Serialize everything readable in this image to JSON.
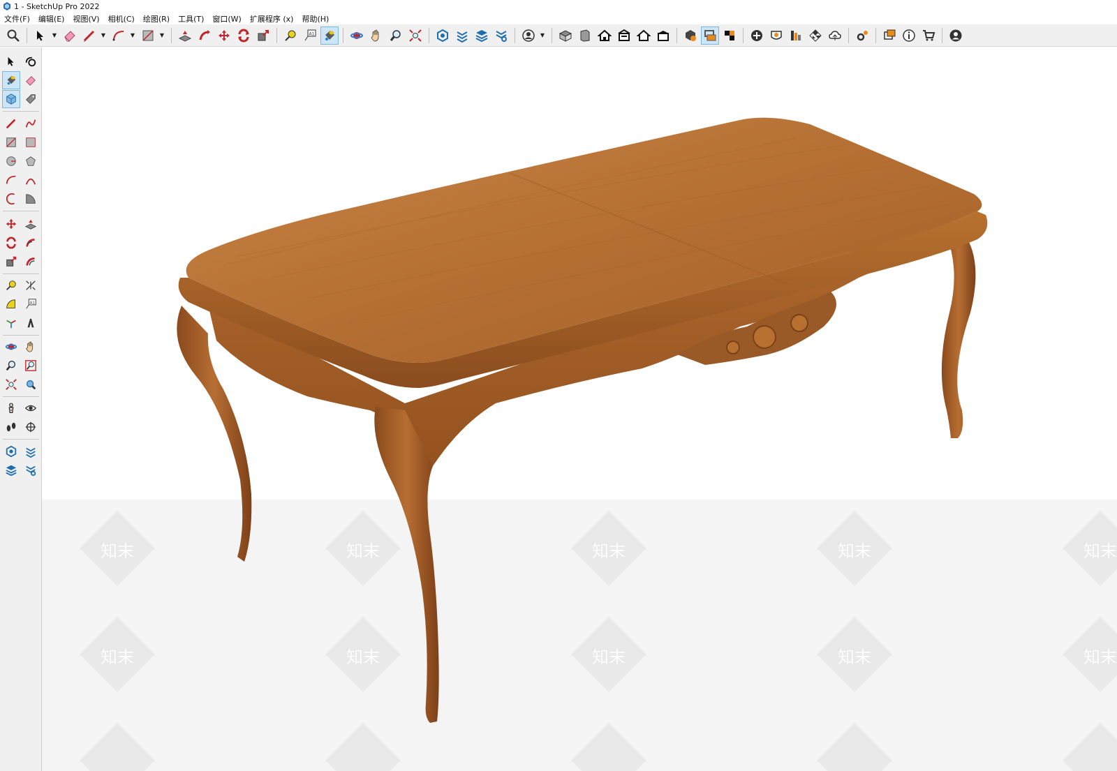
{
  "window": {
    "title": "1 - SketchUp Pro 2022"
  },
  "menu": [
    "文件(F)",
    "编辑(E)",
    "视图(V)",
    "相机(C)",
    "绘图(R)",
    "工具(T)",
    "窗口(W)",
    "扩展程序 (x)",
    "帮助(H)"
  ],
  "toolbar": {
    "tools": [
      "search-icon",
      "select-arrow-icon",
      "eraser-icon",
      "pencil-icon",
      "arc-icon",
      "rectangle-icon",
      "push-pull-icon",
      "follow-me-icon",
      "move-icon",
      "rotate-icon",
      "scale-icon",
      "tape-measure-icon",
      "text-icon",
      "paint-bucket-icon",
      "orbit-icon",
      "pan-icon",
      "zoom-icon",
      "zoom-extents-icon",
      "3d-warehouse-icon",
      "extension-warehouse-icon",
      "layout-icon",
      "extension-manager-icon",
      "user-account-icon",
      "iso-view-icon",
      "top-view-icon",
      "front-view-icon",
      "right-view-icon",
      "back-view-icon",
      "left-view-icon",
      "solid-tools-icon",
      "section-plane-icon",
      "display-section-icon",
      "add-location-icon",
      "sandbox-icon",
      "styles-icon",
      "checker-icon",
      "cloud-icon",
      "settings-icon",
      "dialog-icon",
      "info-icon",
      "cart-icon",
      "profile-icon"
    ],
    "active_tool": "paint-bucket-icon"
  },
  "left_tools": [
    [
      "select-icon",
      "orbit-icon"
    ],
    [
      "paint-bucket-icon",
      "eraser-icon"
    ],
    [
      "component-icon",
      "tag-icon"
    ],
    [
      "pencil-icon",
      "freehand-icon"
    ],
    [
      "rectangle-icon",
      "rotated-rectangle-icon"
    ],
    [
      "circle-icon",
      "polygon-icon"
    ],
    [
      "arc-icon",
      "two-point-arc-icon"
    ],
    [
      "three-point-arc-icon",
      "pie-icon"
    ],
    [
      "move-icon",
      "push-pull-icon"
    ],
    [
      "rotate-icon",
      "follow-me-icon"
    ],
    [
      "scale-icon",
      "offset-icon"
    ],
    [
      "tape-measure-icon",
      "dimension-icon"
    ],
    [
      "protractor-icon",
      "text-icon"
    ],
    [
      "axes-icon",
      "3d-text-icon"
    ],
    [
      "orbit-icon",
      "pan-icon"
    ],
    [
      "zoom-icon",
      "zoom-window-icon"
    ],
    [
      "zoom-extents-icon",
      "previous-view-icon"
    ],
    [
      "position-camera-icon",
      "look-around-icon"
    ],
    [
      "walk-icon",
      "section-plane-icon"
    ],
    [
      "3d-warehouse-icon",
      "extension-warehouse-icon"
    ],
    [
      "layout-icon",
      "extension-manager-icon"
    ]
  ],
  "watermark": {
    "text": "知末"
  },
  "colors": {
    "wood_light": "#c07a3c",
    "wood_mid": "#a35f28",
    "wood_dark": "#7a4118",
    "active_tool_bg": "#cde6f7"
  }
}
